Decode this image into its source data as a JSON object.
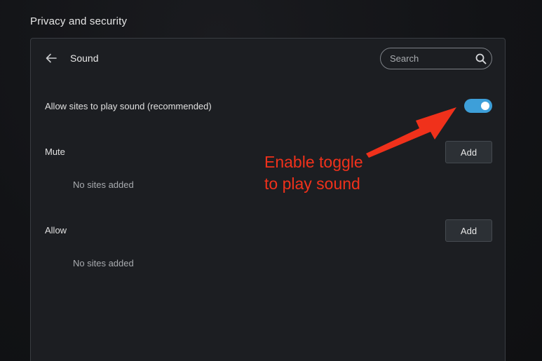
{
  "header": {
    "section_title": "Privacy and security"
  },
  "card": {
    "back_icon": "arrow-left-icon",
    "title": "Sound",
    "search": {
      "placeholder": "Search",
      "value": "",
      "icon": "search-icon"
    },
    "allow_sound": {
      "label": "Allow sites to play sound (recommended)",
      "enabled": true,
      "toggle_color": "#3d9fd9"
    },
    "mute": {
      "label": "Mute",
      "add_label": "Add",
      "empty_text": "No sites added"
    },
    "allow": {
      "label": "Allow",
      "add_label": "Add",
      "empty_text": "No sites added"
    }
  },
  "annotation": {
    "line1": "Enable toggle",
    "line2": "to play sound",
    "color": "#f0311b"
  }
}
